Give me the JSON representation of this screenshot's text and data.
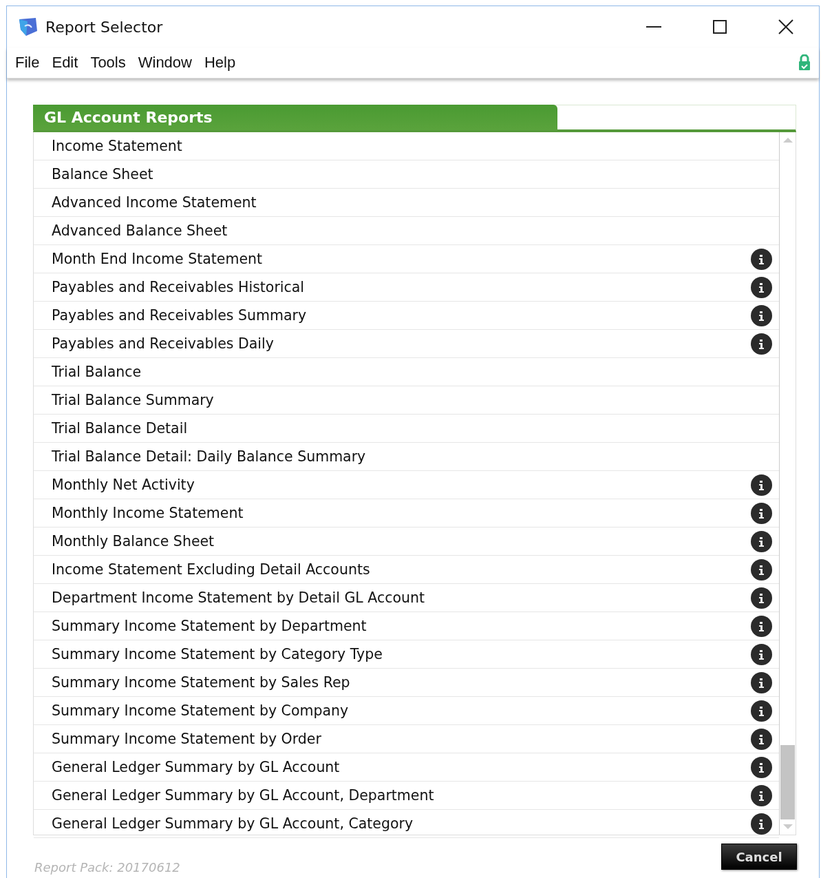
{
  "window": {
    "title": "Report Selector"
  },
  "menu": [
    "File",
    "Edit",
    "Tools",
    "Window",
    "Help"
  ],
  "panel": {
    "title": "GL Account Reports",
    "reports": [
      {
        "label": "Income Statement",
        "info": false
      },
      {
        "label": "Balance Sheet",
        "info": false
      },
      {
        "label": "Advanced Income Statement",
        "info": false
      },
      {
        "label": "Advanced Balance Sheet",
        "info": false
      },
      {
        "label": "Month End Income Statement",
        "info": true
      },
      {
        "label": "Payables and Receivables Historical",
        "info": true
      },
      {
        "label": "Payables and Receivables Summary",
        "info": true
      },
      {
        "label": "Payables and Receivables Daily",
        "info": true
      },
      {
        "label": "Trial Balance",
        "info": false
      },
      {
        "label": "Trial Balance Summary",
        "info": false
      },
      {
        "label": "Trial Balance Detail",
        "info": false
      },
      {
        "label": "Trial Balance Detail: Daily Balance Summary",
        "info": false
      },
      {
        "label": "Monthly Net Activity",
        "info": true
      },
      {
        "label": "Monthly Income Statement",
        "info": true
      },
      {
        "label": "Monthly Balance Sheet",
        "info": true
      },
      {
        "label": "Income Statement Excluding Detail Accounts",
        "info": true
      },
      {
        "label": "Department Income Statement by Detail GL Account",
        "info": true
      },
      {
        "label": "Summary Income Statement by Department",
        "info": true
      },
      {
        "label": "Summary Income Statement by Category Type",
        "info": true
      },
      {
        "label": "Summary Income Statement by Sales Rep",
        "info": true
      },
      {
        "label": "Summary Income Statement by Company",
        "info": true
      },
      {
        "label": "Summary Income Statement by Order",
        "info": true
      },
      {
        "label": "General Ledger Summary by GL Account",
        "info": true
      },
      {
        "label": "General Ledger Summary by GL Account, Department",
        "info": true
      },
      {
        "label": "General Ledger Summary by GL Account, Category",
        "info": true
      }
    ]
  },
  "footer": {
    "report_pack": "Report Pack: 20170612",
    "cancel_button": "Cancel"
  }
}
